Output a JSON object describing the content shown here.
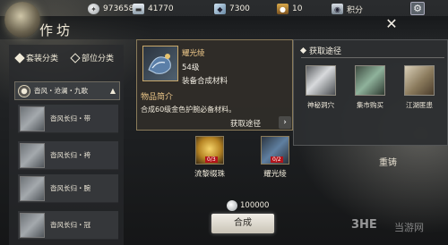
{
  "currencies": [
    {
      "icon": "silver-coin-icon",
      "value": "973658"
    },
    {
      "icon": "silver-ingot-icon",
      "value": "41770"
    },
    {
      "icon": "gem-icon",
      "value": "7300"
    },
    {
      "icon": "bag-icon",
      "value": "10"
    },
    {
      "icon": "jade-icon",
      "value": "积分"
    }
  ],
  "window": {
    "title": "作坊"
  },
  "filters": {
    "set_label": "套装分类",
    "part_label": "部位分类"
  },
  "group": {
    "label": "沓风・沧澜・九歌"
  },
  "items": [
    {
      "label": "沓风长归・带"
    },
    {
      "label": "沓风长归・袴"
    },
    {
      "label": "沓风长归・腕"
    },
    {
      "label": "沓风长归・冠"
    }
  ],
  "detail": {
    "name": "耀光绫",
    "level": "54级",
    "type": "装备合成材料",
    "intro_heading": "物品简介",
    "description": "合成60级金色护腕必备材料。",
    "source_link": "获取途径"
  },
  "sources": {
    "heading": "获取途径",
    "items": [
      {
        "label": "神秘洞穴"
      },
      {
        "label": "集市购买"
      },
      {
        "label": "江湖匪患"
      }
    ]
  },
  "materials": [
    {
      "label": "流黎缀珠",
      "count": "0/3"
    },
    {
      "label": "耀光绫",
      "count": "0/2"
    }
  ],
  "cost": {
    "value": "100000"
  },
  "actions": {
    "craft": "合成",
    "reforge": "重铸"
  },
  "watermark": {
    "logo": "3HE",
    "site": "当游网"
  },
  "colors": {
    "accent_gold": "#efc98a",
    "badge_red": "#b3141a"
  }
}
